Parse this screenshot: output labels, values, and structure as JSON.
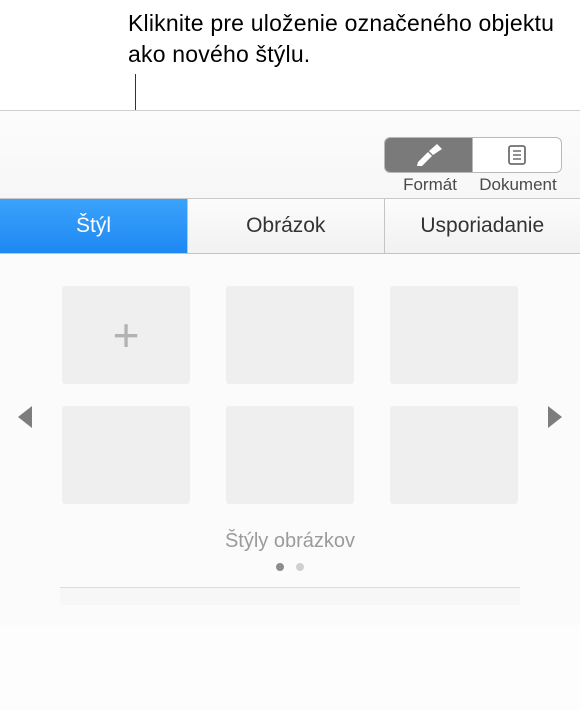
{
  "callout": {
    "text": "Kliknite pre uloženie označeného objektu ako nového štýlu."
  },
  "toolbar": {
    "format": {
      "label": "Formát"
    },
    "document": {
      "label": "Dokument"
    }
  },
  "tabs": {
    "styl": "Štýl",
    "obrazok": "Obrázok",
    "usporiadanie": "Usporiadanie"
  },
  "styles": {
    "caption": "Štýly obrázkov",
    "add_icon": "plus-icon",
    "page_count": 2,
    "active_page": 0
  }
}
